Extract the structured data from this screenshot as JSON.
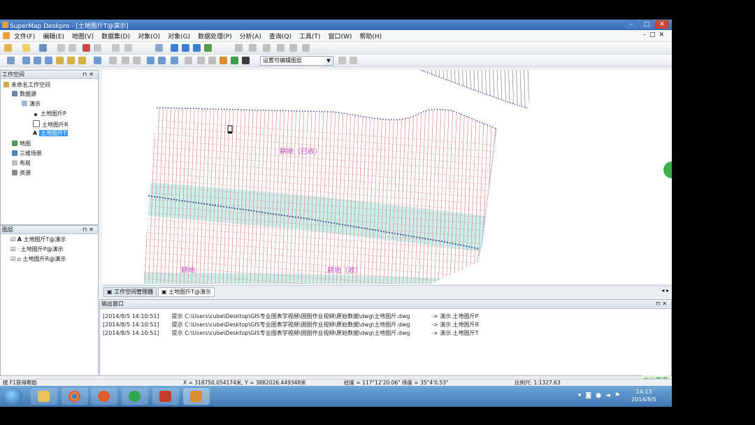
{
  "window": {
    "title": "SuperMap Deskpro - [土地图斤T@演示]"
  },
  "menu": [
    "文件(F)",
    "编辑(E)",
    "地图(V)",
    "数据集(D)",
    "对象(O)",
    "对象(G)",
    "数据处理(P)",
    "分析(A)",
    "查询(Q)",
    "工具(T)",
    "窗口(W)",
    "帮助(H)"
  ],
  "toolbar": {
    "layer_select": "设置可编辑图层"
  },
  "workspace": {
    "title": "工作空间",
    "root": "未命名工作空间",
    "datasources": "数据源",
    "datasource_name": "演示",
    "datasets": [
      "土地图斤P",
      "土地图斤R",
      "土地图斤T"
    ],
    "maps": "地图",
    "scenes": "三维场景",
    "layouts": "布局",
    "resources": "资源"
  },
  "layers": {
    "title": "图层",
    "items": [
      "土地图斤T@演示",
      "土地图斤P@演示",
      "土地图斤R@演示"
    ]
  },
  "map_labels": [
    "耕地（已收）",
    "耕地",
    "耕地（收）"
  ],
  "tabs": {
    "workspace_tab": "工作空间管理器",
    "map_tab": "土地图斤T@演示"
  },
  "output": {
    "title": "输出窗口",
    "lines": [
      {
        "time": "[2014/8/5 14:10:51]",
        "msg": "提示 C:\\Users\\cube\\Desktop\\GIS专业图表学视频\\国图作业视频\\原始数据\\dwg\\土地图斤.dwg",
        "target": "-> 演示.土地图斤P"
      },
      {
        "time": "[2014/8/5 14:10:51]",
        "msg": "提示 C:\\Users\\cube\\Desktop\\GIS专业图表学视频\\国图作业视频\\原始数据\\dwg\\土地图斤.dwg",
        "target": "-> 演示.土地图斤R"
      },
      {
        "time": "[2014/8/5 14:10:51]",
        "msg": "提示 C:\\Users\\cube\\Desktop\\GIS专业图表学视频\\国图作业视频\\原始数据\\dwg\\土地图斤.dwg",
        "target": "-> 演示.土地图斤T"
      }
    ]
  },
  "status": {
    "help": "按 F1获得帮助",
    "xy": "X = 318750.054174米, Y = 3882026.449348米",
    "lonlat": "经度 = 117°12'20.06\" 纬度 = 35°4'0.53\"",
    "scale": "比例尺: 1:1327.63"
  },
  "watermark": "中公教育",
  "clock": {
    "time": "14:13",
    "date": "2014/8/5"
  },
  "colors": {
    "titlebar": "#2f66b4",
    "parcel_lines": "#d9777a",
    "boundary": "#2a3d8f",
    "road_fill": "#7fd6d0",
    "label": "#c653c9"
  }
}
